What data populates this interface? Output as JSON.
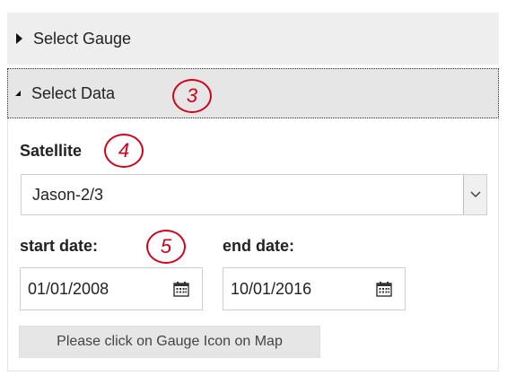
{
  "accordion": {
    "gauge_header": "Select Gauge",
    "data_header": "Select Data"
  },
  "satellite": {
    "label": "Satellite",
    "selected": "Jason-2/3"
  },
  "dates": {
    "start_label": "start date:",
    "start_value": "01/01/2008",
    "end_label": "end date:",
    "end_value": "10/01/2016"
  },
  "gauge_button": "Please click on Gauge Icon on Map",
  "annotations": [
    "3",
    "4",
    "5"
  ],
  "colors": {
    "annotation": "#d0021b",
    "header_bg": "#eeeeee",
    "button_bg": "#e6e6e6"
  }
}
